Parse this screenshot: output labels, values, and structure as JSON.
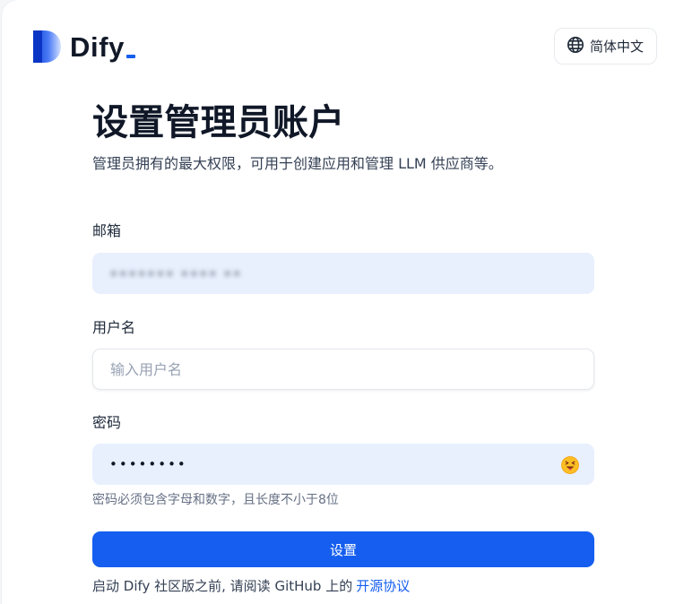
{
  "app": {
    "logo_text": "Dify",
    "accent_color": "#155eef"
  },
  "header": {
    "language_label": "简体中文",
    "language_icon": "globe-icon"
  },
  "page": {
    "title": "设置管理员账户",
    "subtitle": "管理员拥有的最大权限，可用于创建应用和管理 LLM 供应商等。"
  },
  "form": {
    "email": {
      "label": "邮箱",
      "value_obscured": "••••••• •••• ••"
    },
    "username": {
      "label": "用户名",
      "value": "",
      "placeholder": "输入用户名"
    },
    "password": {
      "label": "密码",
      "value": "••••••••",
      "toggle_icon": "emoji-face-icon"
    },
    "password_hint": "密码必须包含字母和数字，且长度不小于8位",
    "submit_label": "设置"
  },
  "footer": {
    "note_prefix": "启动 Dify 社区版之前, 请阅读 GitHub 上的",
    "license_link": "开源协议"
  }
}
